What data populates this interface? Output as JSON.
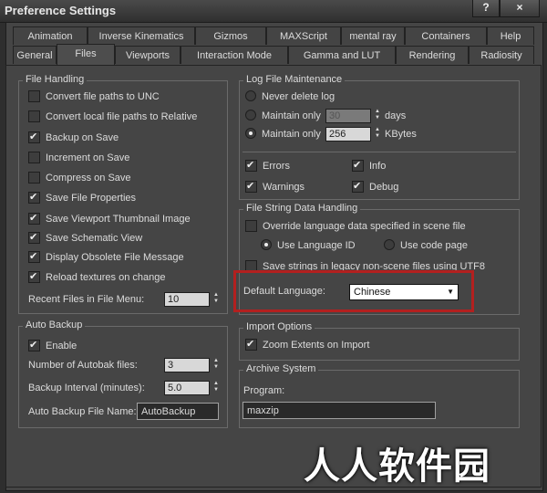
{
  "window": {
    "title": "Preference Settings",
    "help_label": "?",
    "close_label": "×"
  },
  "tabs_row1": [
    "Animation",
    "Inverse Kinematics",
    "Gizmos",
    "MAXScript",
    "mental ray",
    "Containers",
    "Help"
  ],
  "tabs_row2": [
    "General",
    "Files",
    "Viewports",
    "Interaction Mode",
    "Gamma and LUT",
    "Rendering",
    "Radiosity"
  ],
  "active_tab": "Files",
  "file_handling": {
    "title": "File Handling",
    "items": [
      {
        "label": "Convert file paths to UNC",
        "checked": false
      },
      {
        "label": "Convert local file paths to Relative",
        "checked": false
      },
      {
        "label": "Backup on Save",
        "checked": true
      },
      {
        "label": "Increment on Save",
        "checked": false
      },
      {
        "label": "Compress on Save",
        "checked": false
      },
      {
        "label": "Save File Properties",
        "checked": true
      },
      {
        "label": "Save Viewport Thumbnail Image",
        "checked": true
      },
      {
        "label": "Save Schematic View",
        "checked": true
      },
      {
        "label": "Display Obsolete File Message",
        "checked": true
      },
      {
        "label": "Reload textures on change",
        "checked": true
      }
    ],
    "recent_label": "Recent Files in File Menu:",
    "recent_value": "10"
  },
  "auto_backup": {
    "title": "Auto Backup",
    "enable_label": "Enable",
    "enable_checked": true,
    "num_files_label": "Number of Autobak files:",
    "num_files_value": "3",
    "interval_label": "Backup Interval (minutes):",
    "interval_value": "5.0",
    "file_name_label": "Auto Backup File Name:",
    "file_name_value": "AutoBackup"
  },
  "log": {
    "title": "Log File Maintenance",
    "never_label": "Never delete log",
    "maintain_days_label": "Maintain only",
    "maintain_days_value": "30",
    "days_unit": "days",
    "maintain_kb_label": "Maintain only",
    "maintain_kb_value": "256",
    "kb_unit": "KBytes",
    "selected": "kbytes",
    "errors_label": "Errors",
    "errors_checked": true,
    "info_label": "Info",
    "info_checked": true,
    "warnings_label": "Warnings",
    "warnings_checked": true,
    "debug_label": "Debug",
    "debug_checked": true
  },
  "string_handling": {
    "title": "File String Data Handling",
    "override_label": "Override language data specified in scene file",
    "override_checked": false,
    "use_lang_id_label": "Use Language ID",
    "use_code_page_label": "Use code page",
    "selected": "language-id",
    "legacy_label": "Save strings in legacy non-scene files using UTF8",
    "legacy_checked": false,
    "default_language_label": "Default Language:",
    "default_language_value": "Chinese"
  },
  "import": {
    "title": "Import Options",
    "zoom_label": "Zoom Extents on Import",
    "zoom_checked": true
  },
  "archive": {
    "title": "Archive System",
    "program_label": "Program:",
    "program_value": "maxzip"
  },
  "watermark": {
    "text": "人人软件园"
  },
  "colors": {
    "highlight": "#b3201f",
    "panel": "#454545",
    "background": "#2e2e2e"
  }
}
